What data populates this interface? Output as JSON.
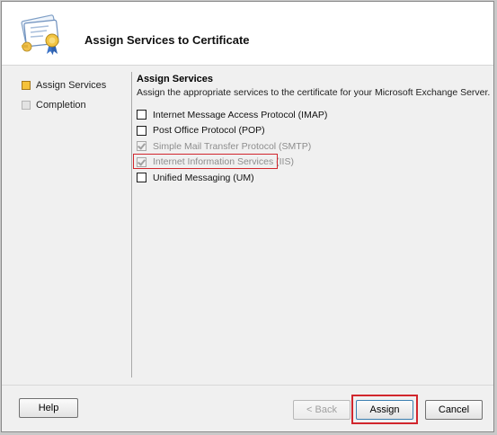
{
  "header": {
    "title": "Assign Services to Certificate",
    "icon": "certificate-icon"
  },
  "steps": [
    {
      "label": "Assign Services",
      "state": "active"
    },
    {
      "label": "Completion",
      "state": "inactive"
    }
  ],
  "content": {
    "title": "Assign Services",
    "description": "Assign the appropriate services to the certificate for your Microsoft Exchange Server."
  },
  "services": [
    {
      "label": "Internet Message Access Protocol (IMAP)",
      "checked": false,
      "disabled": false
    },
    {
      "label": "Post Office Protocol (POP)",
      "checked": false,
      "disabled": false
    },
    {
      "label": "Simple Mail Transfer Protocol (SMTP)",
      "checked": true,
      "disabled": true
    },
    {
      "label": "Internet Information Services (IIS)",
      "checked": true,
      "disabled": true,
      "highlighted": true
    },
    {
      "label": "Unified Messaging (UM)",
      "checked": false,
      "disabled": false
    }
  ],
  "buttons": {
    "help": "Help",
    "back": "< Back",
    "assign": "Assign",
    "cancel": "Cancel"
  },
  "colors": {
    "highlight": "#d1262d",
    "active_step": "#f5c23a"
  }
}
